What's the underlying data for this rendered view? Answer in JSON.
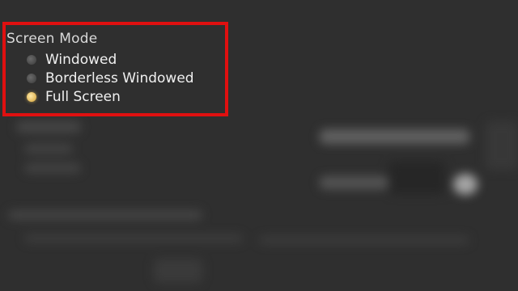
{
  "screen_mode": {
    "title": "Screen Mode",
    "options": [
      {
        "label": "Windowed",
        "selected": false
      },
      {
        "label": "Borderless Windowed",
        "selected": false
      },
      {
        "label": "Full Screen",
        "selected": true
      }
    ]
  },
  "colors": {
    "highlight": "#e01010",
    "selected_radio": "#e0b656",
    "background": "#2f2f2f"
  }
}
